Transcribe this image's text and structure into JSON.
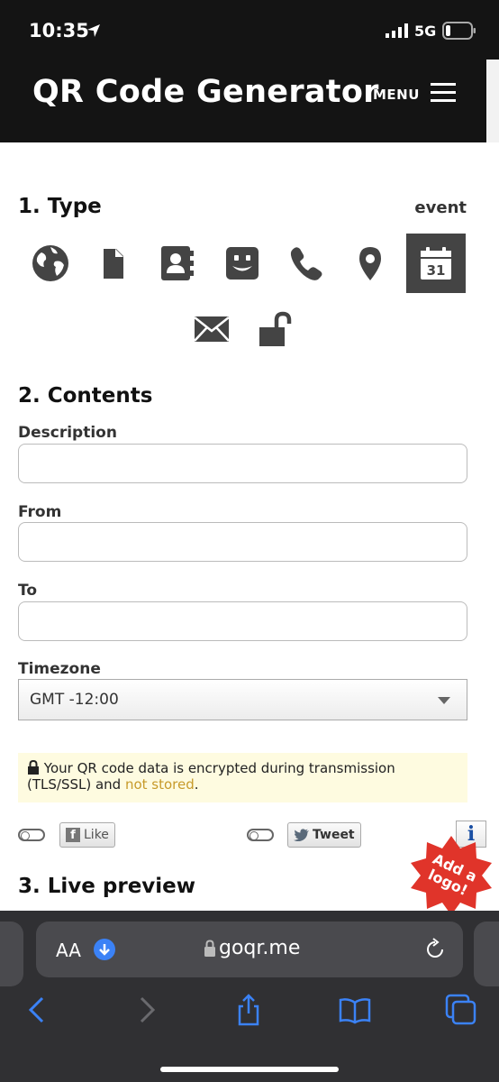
{
  "status": {
    "time": "10:35",
    "network": "5G"
  },
  "header": {
    "title": "QR Code Generator",
    "menu_label": "MENU"
  },
  "type_section": {
    "heading": "1. Type",
    "selected_label": "event",
    "icons": [
      "globe-icon",
      "file-icon",
      "contact-card-icon",
      "smiley-icon",
      "phone-icon",
      "location-pin-icon",
      "calendar-icon",
      "email-icon",
      "unlock-icon"
    ],
    "calendar_day": "31"
  },
  "contents": {
    "heading": "2. Contents",
    "description_label": "Description",
    "description_value": "",
    "from_label": "From",
    "from_value": "",
    "to_label": "To",
    "to_value": "",
    "timezone_label": "Timezone",
    "timezone_value": "GMT -12:00"
  },
  "notice": {
    "text": "Your QR code data is encrypted during transmission (TLS/SSL) and ",
    "link": "not stored",
    "end": "."
  },
  "social": {
    "like_label": "Like",
    "tweet_label": "Tweet",
    "info_label": "i"
  },
  "logo_badge": {
    "line1": "Add a",
    "line2": "logo!"
  },
  "preview": {
    "heading": "3. Live preview"
  },
  "browser": {
    "text_size_label": "AA",
    "url": "goqr.me"
  },
  "colors": {
    "dark": "#141414",
    "badge": "#e0342a",
    "accent_link": "#c79a2a",
    "safari_blue": "#3b82f6"
  }
}
